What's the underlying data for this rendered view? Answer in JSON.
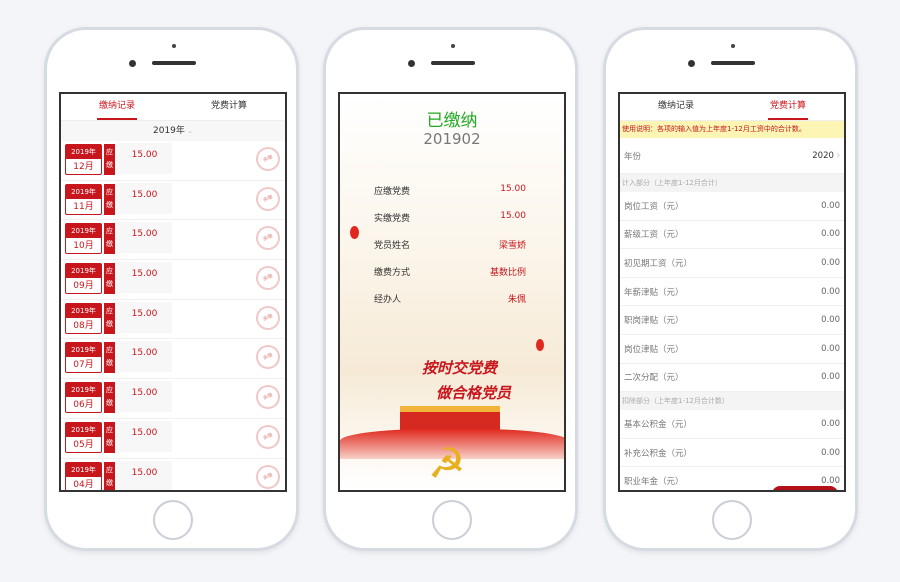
{
  "tabs": {
    "records": "缴纳记录",
    "calc": "党费计算"
  },
  "records": {
    "year_filter": "2019年",
    "due_label": "应缴",
    "stamp": "未缴",
    "rows": [
      {
        "year": "2019年",
        "month": "12月",
        "amount": "15.00"
      },
      {
        "year": "2019年",
        "month": "11月",
        "amount": "15.00"
      },
      {
        "year": "2019年",
        "month": "10月",
        "amount": "15.00"
      },
      {
        "year": "2019年",
        "month": "09月",
        "amount": "15.00"
      },
      {
        "year": "2019年",
        "month": "08月",
        "amount": "15.00"
      },
      {
        "year": "2019年",
        "month": "07月",
        "amount": "15.00"
      },
      {
        "year": "2019年",
        "month": "06月",
        "amount": "15.00"
      },
      {
        "year": "2019年",
        "month": "05月",
        "amount": "15.00"
      },
      {
        "year": "2019年",
        "month": "04月",
        "amount": "15.00"
      }
    ]
  },
  "detail": {
    "status": "已缴纳",
    "period": "201902",
    "items": [
      {
        "label": "应缴党费",
        "value": "15.00"
      },
      {
        "label": "实缴党费",
        "value": "15.00"
      },
      {
        "label": "党员姓名",
        "value": "梁雪娇"
      },
      {
        "label": "缴费方式",
        "value": "基数比例"
      },
      {
        "label": "经办人",
        "value": "朱佩"
      }
    ],
    "slogan_line1": "按时交党费",
    "slogan_line2": "做合格党员"
  },
  "calc": {
    "notice": "使用说明：各项的输入值为上年度1-12月工资中的合计数。",
    "year_label": "年份",
    "year_value": "2020",
    "income_section": "计入部分（上年度1-12月合计）",
    "income": [
      {
        "label": "岗位工资（元）",
        "value": "0.00"
      },
      {
        "label": "薪级工资（元）",
        "value": "0.00"
      },
      {
        "label": "初见期工资（元）",
        "value": "0.00"
      },
      {
        "label": "年薪津贴（元）",
        "value": "0.00"
      },
      {
        "label": "职岗津贴（元）",
        "value": "0.00"
      },
      {
        "label": "岗位津贴（元）",
        "value": "0.00"
      },
      {
        "label": "二次分配（元）",
        "value": "0.00"
      }
    ],
    "deduct_section": "扣除部分（上年度1-12月合计数）",
    "deduct": [
      {
        "label": "基本公积金（元）",
        "value": "0.00"
      },
      {
        "label": "补充公积金（元）",
        "value": "0.00"
      },
      {
        "label": "职业年金（元）",
        "value": "0.00"
      }
    ]
  },
  "colors": {
    "accent": "#c8161d",
    "paid": "#22aa22",
    "notice_bg": "#fdf5b4"
  }
}
